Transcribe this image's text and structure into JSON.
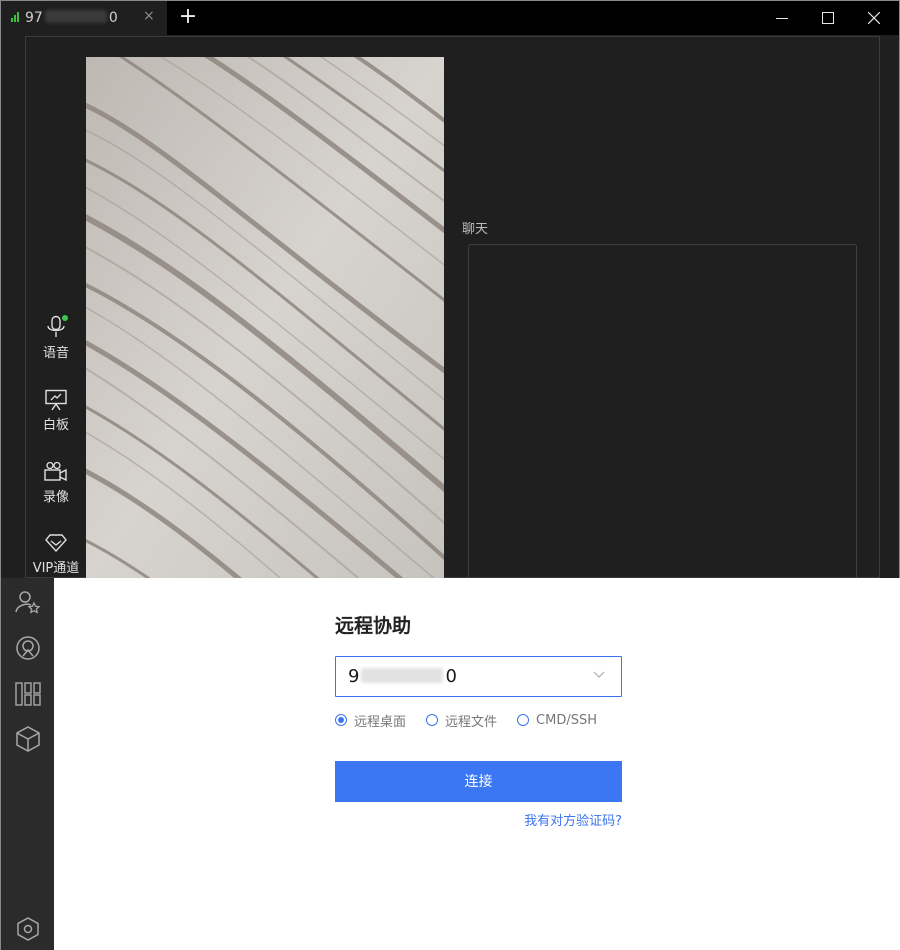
{
  "window": {
    "tab": {
      "title_start": "97",
      "title_end": "0",
      "close_glyph": "×"
    },
    "new_tab_glyph": "+",
    "controls": [
      "minimize-icon",
      "maximize-icon",
      "close-icon"
    ]
  },
  "session": {
    "chat_label": "聊天",
    "tools": [
      {
        "icon": "microphone-icon",
        "label": "语音",
        "active": true
      },
      {
        "icon": "whiteboard-icon",
        "label": "白板"
      },
      {
        "icon": "video-camera-icon",
        "label": "录像"
      },
      {
        "icon": "diamond-icon",
        "label": "VIP通道"
      }
    ],
    "active_color": "#3fc54f"
  },
  "rail": {
    "items": [
      "user-star-icon",
      "remote-assist-icon",
      "apps-grid-icon",
      "cube-icon"
    ],
    "bottom_item": "settings-hexagon-icon"
  },
  "remote_assist": {
    "title": "远程协助",
    "device_id_start": "9",
    "device_id_end": "0",
    "modes": [
      {
        "label": "远程桌面",
        "selected": true
      },
      {
        "label": "远程文件",
        "selected": false
      },
      {
        "label": "CMD/SSH",
        "selected": false
      }
    ],
    "connect_label": "连接",
    "verify_link": "我有对方验证码?",
    "accent_color": "#3b76f3"
  }
}
